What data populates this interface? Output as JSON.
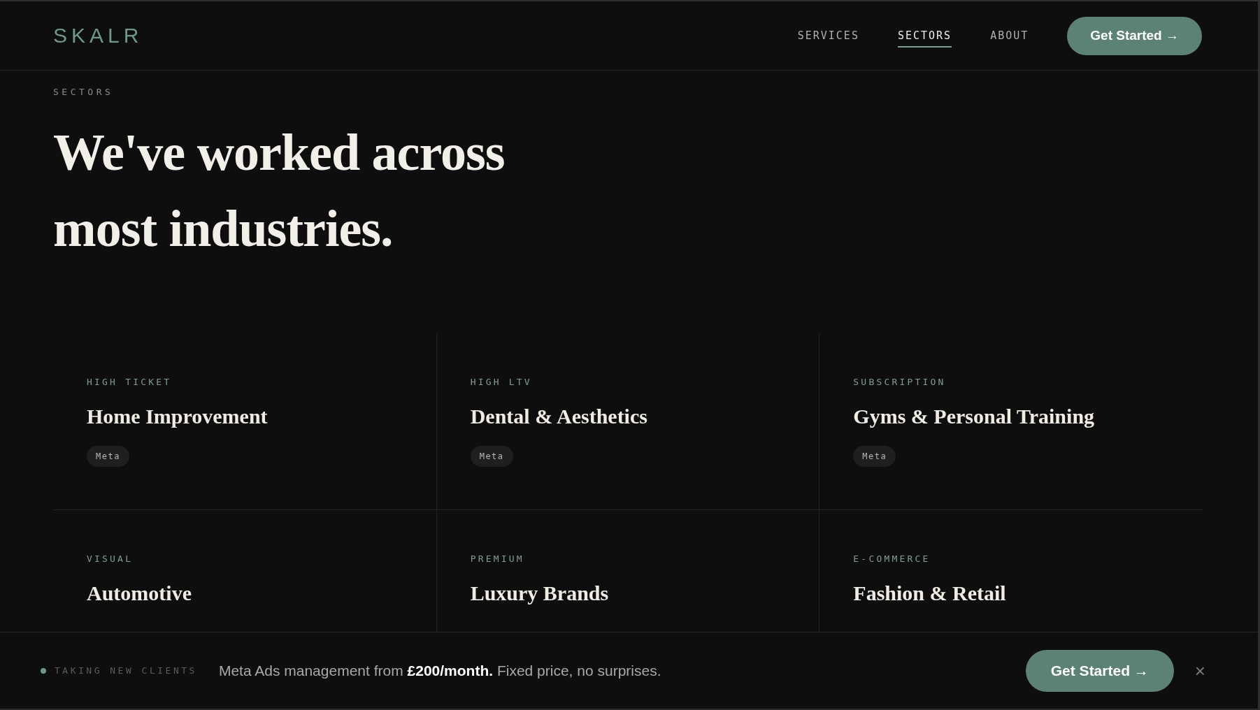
{
  "header": {
    "logo": "SKALR",
    "nav": [
      {
        "label": "SERVICES",
        "selected": false
      },
      {
        "label": "SECTORS",
        "selected": true
      },
      {
        "label": "ABOUT",
        "selected": false
      }
    ],
    "cta": "Get Started →"
  },
  "hero": {
    "eyebrow": "SECTORS",
    "title_lines": [
      "We've worked across",
      "most industries."
    ]
  },
  "sectors": [
    {
      "category": "HIGH TICKET",
      "name": "Home Improvement",
      "tags": [
        "Meta"
      ]
    },
    {
      "category": "HIGH LTV",
      "name": "Dental & Aesthetics",
      "tags": [
        "Meta"
      ]
    },
    {
      "category": "SUBSCRIPTION",
      "name": "Gyms & Personal Training",
      "tags": [
        "Meta"
      ]
    },
    {
      "category": "VISUAL",
      "name": "Automotive"
    },
    {
      "category": "PREMIUM",
      "name": "Luxury Brands"
    },
    {
      "category": "E-COMMERCE",
      "name": "Fashion & Retail"
    }
  ],
  "banner": {
    "status": "TAKING NEW CLIENTS",
    "message": "Meta Ads management from **£200/month.** Fixed price, no surprises.",
    "cta": "Get Started →",
    "close": "×"
  }
}
